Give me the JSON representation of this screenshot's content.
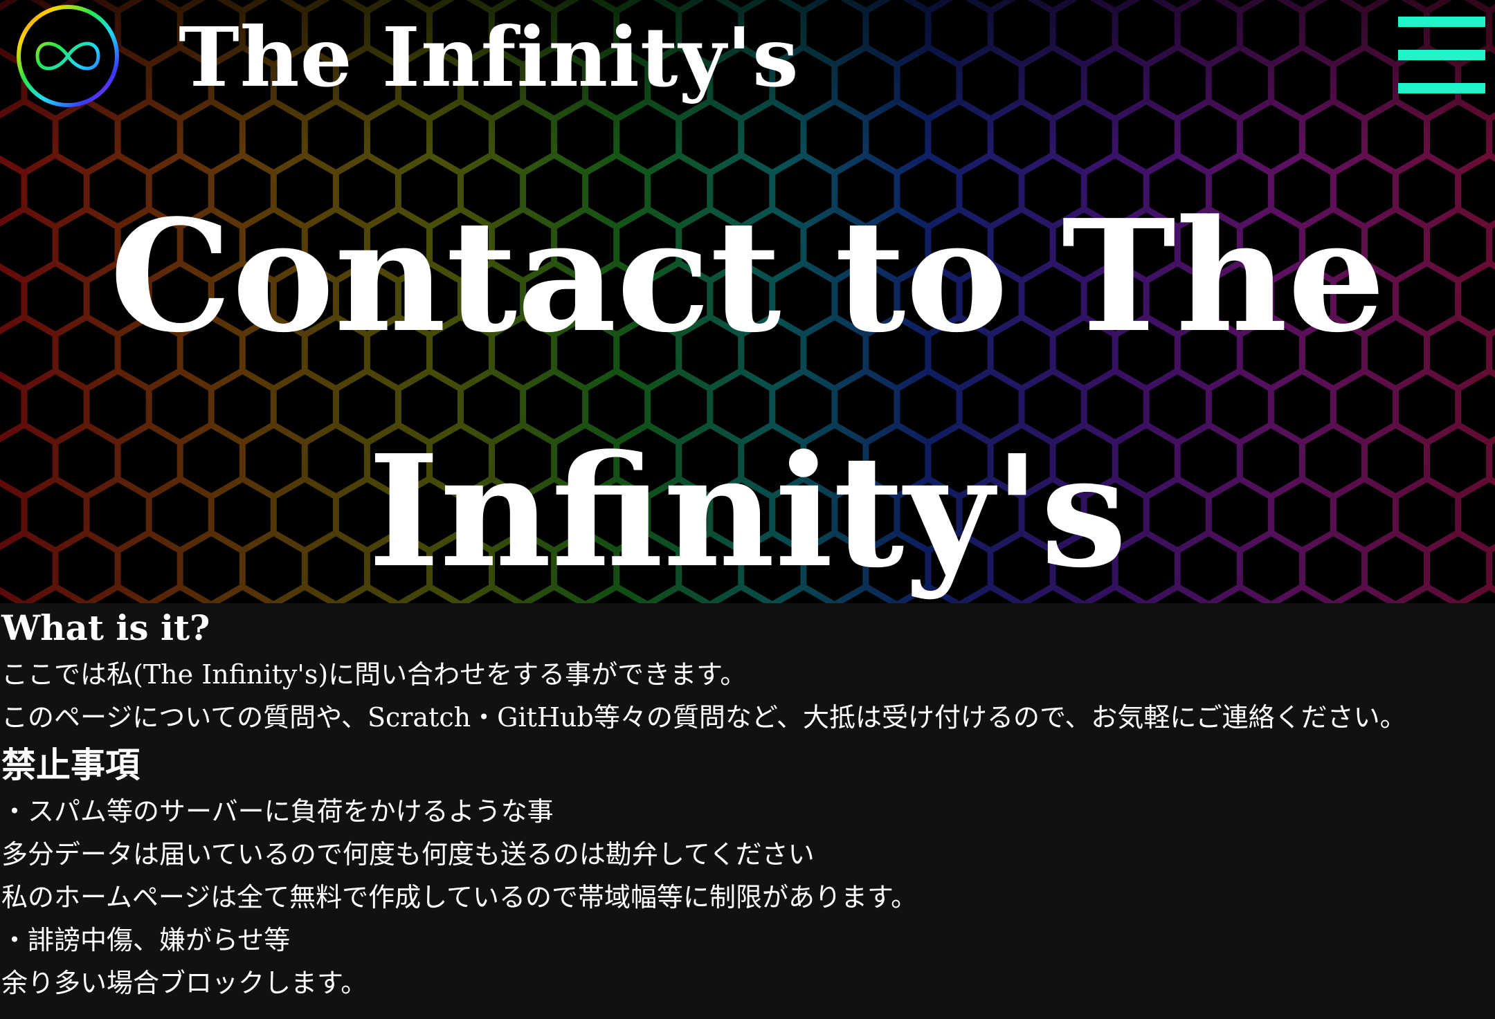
{
  "header": {
    "site_title": "The Infinity's",
    "logo_icon": "infinity-ring-logo-icon",
    "menu_icon": "hamburger-menu-icon",
    "menu_color": "#1ef5c8"
  },
  "hero": {
    "title": "Contact to The Infinity's",
    "background": "rainbow-hexagon-pattern"
  },
  "content": {
    "what_heading": "What is it?",
    "what_lines": [
      "ここでは私(The Infinity's)に問い合わせをする事ができます。",
      "このページについての質問や、Scratch・GitHub等々の質問など、大抵は受け付けるので、お気軽にご連絡ください。"
    ],
    "prohibited_heading": "禁止事項",
    "prohibited_lines": [
      "・スパム等のサーバーに負荷をかけるような事",
      "多分データは届いているので何度も何度も送るのは勘弁してください",
      "私のホームページは全て無料で作成しているので帯域幅等に制限があります。",
      "・誹謗中傷、嫌がらせ等",
      "余り多い場合ブロックします。"
    ]
  }
}
